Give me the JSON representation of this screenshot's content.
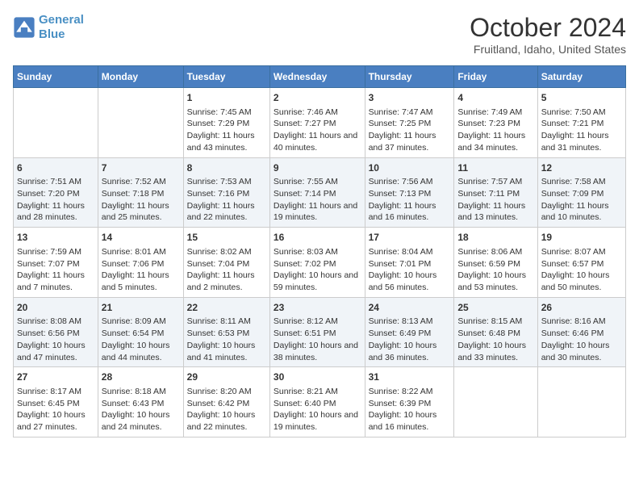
{
  "header": {
    "logo_line1": "General",
    "logo_line2": "Blue",
    "title": "October 2024",
    "location": "Fruitland, Idaho, United States"
  },
  "columns": [
    "Sunday",
    "Monday",
    "Tuesday",
    "Wednesday",
    "Thursday",
    "Friday",
    "Saturday"
  ],
  "weeks": [
    [
      {
        "day": "",
        "info": ""
      },
      {
        "day": "",
        "info": ""
      },
      {
        "day": "1",
        "info": "Sunrise: 7:45 AM\nSunset: 7:29 PM\nDaylight: 11 hours and 43 minutes."
      },
      {
        "day": "2",
        "info": "Sunrise: 7:46 AM\nSunset: 7:27 PM\nDaylight: 11 hours and 40 minutes."
      },
      {
        "day": "3",
        "info": "Sunrise: 7:47 AM\nSunset: 7:25 PM\nDaylight: 11 hours and 37 minutes."
      },
      {
        "day": "4",
        "info": "Sunrise: 7:49 AM\nSunset: 7:23 PM\nDaylight: 11 hours and 34 minutes."
      },
      {
        "day": "5",
        "info": "Sunrise: 7:50 AM\nSunset: 7:21 PM\nDaylight: 11 hours and 31 minutes."
      }
    ],
    [
      {
        "day": "6",
        "info": "Sunrise: 7:51 AM\nSunset: 7:20 PM\nDaylight: 11 hours and 28 minutes."
      },
      {
        "day": "7",
        "info": "Sunrise: 7:52 AM\nSunset: 7:18 PM\nDaylight: 11 hours and 25 minutes."
      },
      {
        "day": "8",
        "info": "Sunrise: 7:53 AM\nSunset: 7:16 PM\nDaylight: 11 hours and 22 minutes."
      },
      {
        "day": "9",
        "info": "Sunrise: 7:55 AM\nSunset: 7:14 PM\nDaylight: 11 hours and 19 minutes."
      },
      {
        "day": "10",
        "info": "Sunrise: 7:56 AM\nSunset: 7:13 PM\nDaylight: 11 hours and 16 minutes."
      },
      {
        "day": "11",
        "info": "Sunrise: 7:57 AM\nSunset: 7:11 PM\nDaylight: 11 hours and 13 minutes."
      },
      {
        "day": "12",
        "info": "Sunrise: 7:58 AM\nSunset: 7:09 PM\nDaylight: 11 hours and 10 minutes."
      }
    ],
    [
      {
        "day": "13",
        "info": "Sunrise: 7:59 AM\nSunset: 7:07 PM\nDaylight: 11 hours and 7 minutes."
      },
      {
        "day": "14",
        "info": "Sunrise: 8:01 AM\nSunset: 7:06 PM\nDaylight: 11 hours and 5 minutes."
      },
      {
        "day": "15",
        "info": "Sunrise: 8:02 AM\nSunset: 7:04 PM\nDaylight: 11 hours and 2 minutes."
      },
      {
        "day": "16",
        "info": "Sunrise: 8:03 AM\nSunset: 7:02 PM\nDaylight: 10 hours and 59 minutes."
      },
      {
        "day": "17",
        "info": "Sunrise: 8:04 AM\nSunset: 7:01 PM\nDaylight: 10 hours and 56 minutes."
      },
      {
        "day": "18",
        "info": "Sunrise: 8:06 AM\nSunset: 6:59 PM\nDaylight: 10 hours and 53 minutes."
      },
      {
        "day": "19",
        "info": "Sunrise: 8:07 AM\nSunset: 6:57 PM\nDaylight: 10 hours and 50 minutes."
      }
    ],
    [
      {
        "day": "20",
        "info": "Sunrise: 8:08 AM\nSunset: 6:56 PM\nDaylight: 10 hours and 47 minutes."
      },
      {
        "day": "21",
        "info": "Sunrise: 8:09 AM\nSunset: 6:54 PM\nDaylight: 10 hours and 44 minutes."
      },
      {
        "day": "22",
        "info": "Sunrise: 8:11 AM\nSunset: 6:53 PM\nDaylight: 10 hours and 41 minutes."
      },
      {
        "day": "23",
        "info": "Sunrise: 8:12 AM\nSunset: 6:51 PM\nDaylight: 10 hours and 38 minutes."
      },
      {
        "day": "24",
        "info": "Sunrise: 8:13 AM\nSunset: 6:49 PM\nDaylight: 10 hours and 36 minutes."
      },
      {
        "day": "25",
        "info": "Sunrise: 8:15 AM\nSunset: 6:48 PM\nDaylight: 10 hours and 33 minutes."
      },
      {
        "day": "26",
        "info": "Sunrise: 8:16 AM\nSunset: 6:46 PM\nDaylight: 10 hours and 30 minutes."
      }
    ],
    [
      {
        "day": "27",
        "info": "Sunrise: 8:17 AM\nSunset: 6:45 PM\nDaylight: 10 hours and 27 minutes."
      },
      {
        "day": "28",
        "info": "Sunrise: 8:18 AM\nSunset: 6:43 PM\nDaylight: 10 hours and 24 minutes."
      },
      {
        "day": "29",
        "info": "Sunrise: 8:20 AM\nSunset: 6:42 PM\nDaylight: 10 hours and 22 minutes."
      },
      {
        "day": "30",
        "info": "Sunrise: 8:21 AM\nSunset: 6:40 PM\nDaylight: 10 hours and 19 minutes."
      },
      {
        "day": "31",
        "info": "Sunrise: 8:22 AM\nSunset: 6:39 PM\nDaylight: 10 hours and 16 minutes."
      },
      {
        "day": "",
        "info": ""
      },
      {
        "day": "",
        "info": ""
      }
    ]
  ]
}
